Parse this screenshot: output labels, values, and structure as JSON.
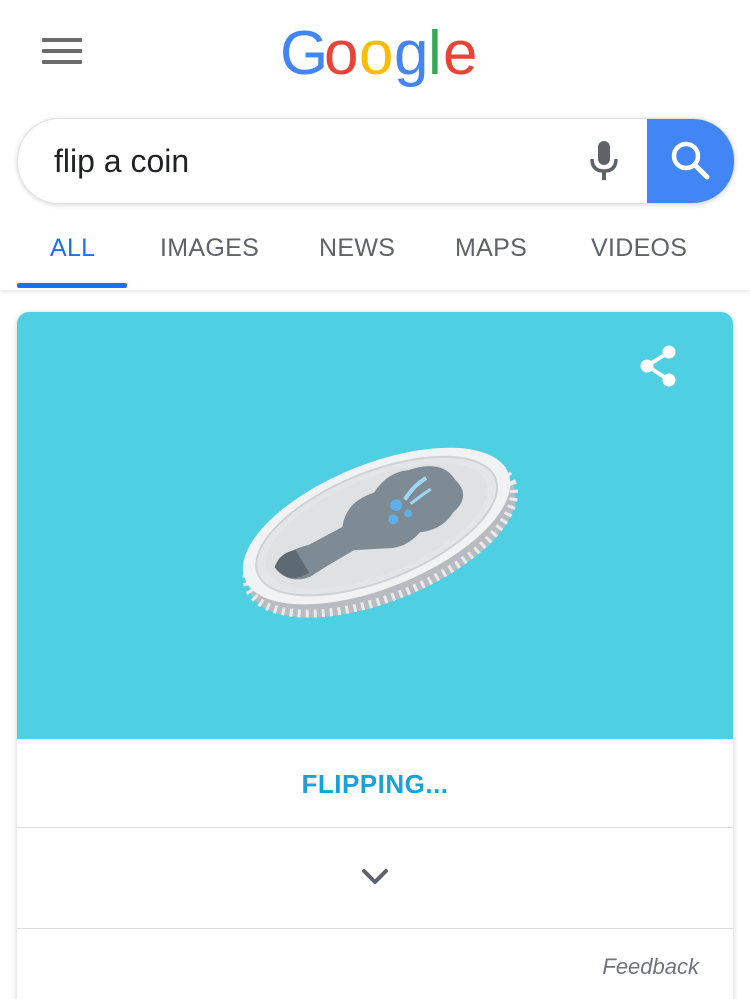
{
  "header": {
    "menu_icon": "hamburger-menu-icon",
    "logo": {
      "letters": [
        "G",
        "o",
        "o",
        "g",
        "l",
        "e"
      ],
      "colors": [
        "#4285f4",
        "#ea4335",
        "#fbbc05",
        "#4285f4",
        "#34a853",
        "#ea4335"
      ]
    }
  },
  "search": {
    "query": "flip a coin",
    "mic_icon": "microphone-icon",
    "search_icon": "magnifier-icon",
    "button_color": "#4285f4"
  },
  "tabs": [
    {
      "label": "ALL",
      "active": true
    },
    {
      "label": "IMAGES",
      "active": false
    },
    {
      "label": "NEWS",
      "active": false
    },
    {
      "label": "MAPS",
      "active": false
    },
    {
      "label": "VIDEOS",
      "active": false
    }
  ],
  "card": {
    "background_color": "#4fcfe2",
    "share_icon": "share-icon",
    "coin_image": "spinning-coin",
    "status": "FLIPPING...",
    "expand_icon": "chevron-down-icon",
    "feedback": "Feedback"
  },
  "colors": {
    "accent": "#1a73e8",
    "status_text": "#1aa1d8"
  }
}
